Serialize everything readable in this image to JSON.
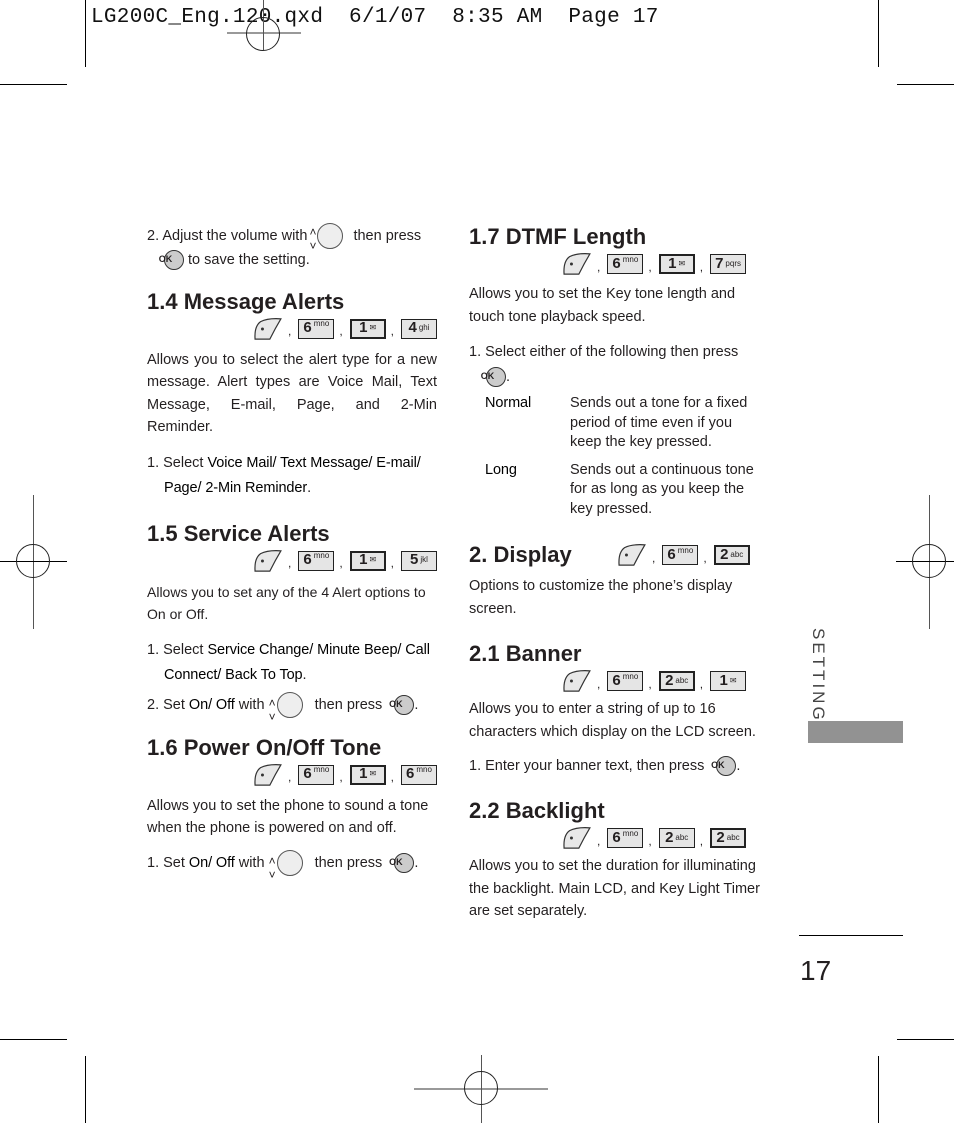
{
  "slug": "LG200C_Eng.120.qxd  6/1/07  8:35 AM  Page 17",
  "left": {
    "step_volume": {
      "num": "2.",
      "before": "Adjust the volume with",
      "mid": "then press",
      "after": "to save the setting."
    },
    "s14": {
      "title": "1.4 Message Alerts",
      "keys": [
        {
          "main": "6",
          "sub": "mno"
        },
        {
          "main": "1",
          "sub": "✉"
        },
        {
          "main": "4",
          "sub": "ghi"
        }
      ],
      "desc": "Allows you to select the alert type for a new message. Alert types are Voice Mail, Text Message, E-mail, Page, and 2-Min Reminder.",
      "step": {
        "num": "1.",
        "prefix": "Select ",
        "bold": "Voice Mail/ Text Message/ E-mail/ Page/ 2-Min Reminder",
        "suffix": "."
      }
    },
    "s15": {
      "title": "1.5 Service Alerts",
      "keys": [
        {
          "main": "6",
          "sub": "mno"
        },
        {
          "main": "1",
          "sub": "✉"
        },
        {
          "main": "5",
          "sub": "jkl"
        }
      ],
      "desc": "Allows you to set any of the 4 Alert options to On or Off.",
      "step1": {
        "num": "1.",
        "prefix": "Select ",
        "bold": "Service Change/ Minute Beep/ Call Connect/ Back To Top",
        "suffix": "."
      },
      "step2": {
        "num": "2.",
        "prefix": "Set ",
        "bold": "On/ Off",
        "mid": " with",
        "then": "then press",
        "suffix": "."
      }
    },
    "s16": {
      "title": "1.6 Power On/Off Tone",
      "keys": [
        {
          "main": "6",
          "sub": "mno"
        },
        {
          "main": "1",
          "sub": "✉"
        },
        {
          "main": "6",
          "sub": "mno"
        }
      ],
      "desc": "Allows you to set the phone to sound a tone when the phone is powered on and off.",
      "step1": {
        "num": "1.",
        "prefix": "Set ",
        "bold": "On/ Off",
        "mid": " with",
        "then": "then press",
        "suffix": "."
      }
    }
  },
  "right": {
    "s17": {
      "title": "1.7 DTMF Length",
      "keys": [
        {
          "main": "6",
          "sub": "mno"
        },
        {
          "main": "1",
          "sub": "✉"
        },
        {
          "main": "7",
          "sub": "pqrs"
        }
      ],
      "desc": "Allows you to set the Key tone length and touch tone playback speed.",
      "step1": {
        "num": "1.",
        "text": "Select either of the following then press"
      },
      "options": [
        {
          "term": "Normal",
          "desc": "Sends out a tone for a fixed period of time even if you keep the key pressed."
        },
        {
          "term": "Long",
          "desc": "Sends out a continuous tone for as long as you keep the key pressed."
        }
      ]
    },
    "s2": {
      "title": "2. Display",
      "keys": [
        {
          "main": "6",
          "sub": "mno"
        },
        {
          "main": "2",
          "sub": "abc"
        }
      ],
      "desc": "Options to customize the phone’s display screen."
    },
    "s21": {
      "title": "2.1 Banner",
      "keys": [
        {
          "main": "6",
          "sub": "mno"
        },
        {
          "main": "2",
          "sub": "abc"
        },
        {
          "main": "1",
          "sub": "✉"
        }
      ],
      "desc": "Allows you to enter a string of up to 16 characters which display on the LCD screen.",
      "step1": {
        "num": "1.",
        "text": "Enter your banner text, then press"
      }
    },
    "s22": {
      "title": "2.2 Backlight",
      "keys": [
        {
          "main": "6",
          "sub": "mno"
        },
        {
          "main": "2",
          "sub": "abc"
        },
        {
          "main": "2",
          "sub": "abc"
        }
      ],
      "desc": "Allows you to set the duration for illuminating the backlight. Main LCD, and Key Light Timer are set separately."
    }
  },
  "sidebar_tab": {
    "label": "SETTINGS",
    "bar_color": "#929292"
  },
  "page_number": "17",
  "icons": {
    "menu_softkey": "left-softkey-icon",
    "nav": "navigation-key-icon",
    "ok": "ok-key-icon",
    "ok_text": "OK"
  }
}
